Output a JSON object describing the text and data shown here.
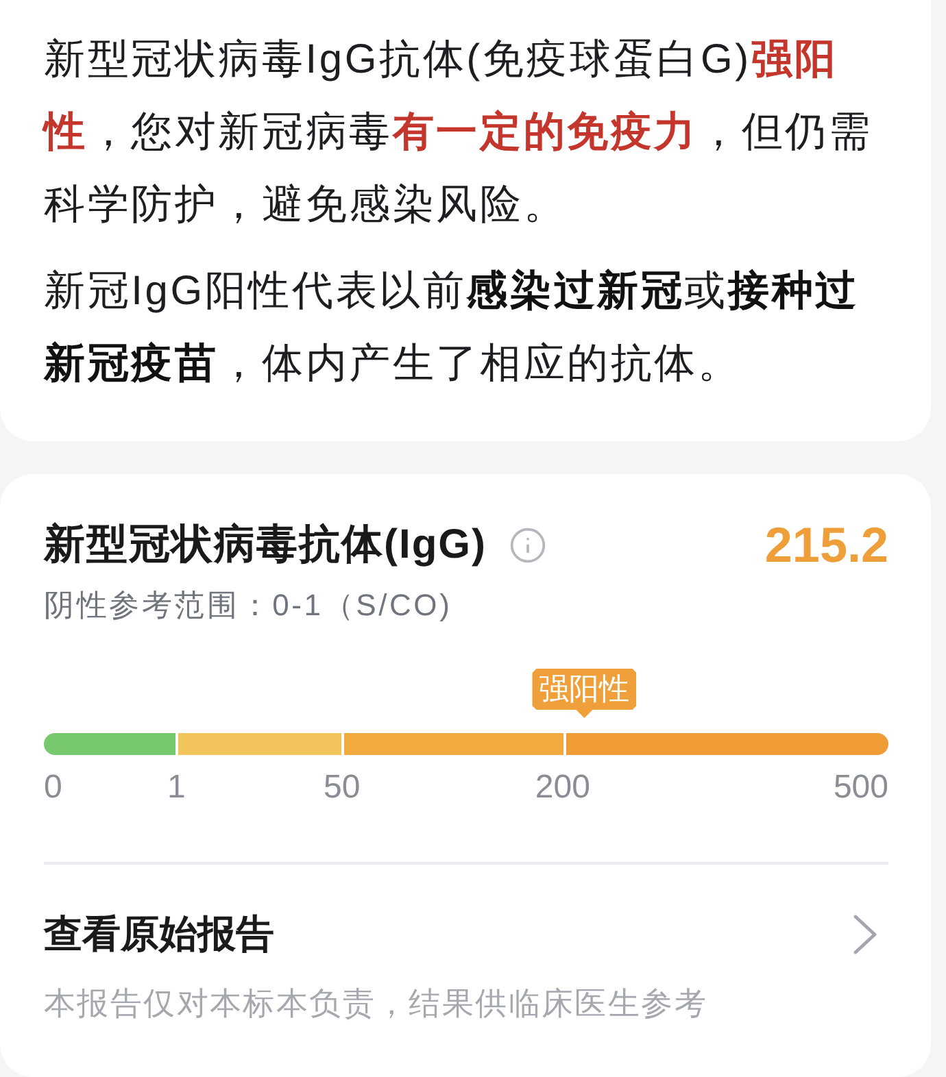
{
  "summary": {
    "paragraphs": [
      {
        "runs": [
          {
            "kind": "plain",
            "text": "新型冠状病毒IgG抗体(免疫球蛋白G)"
          },
          {
            "kind": "highlight",
            "text": "强阳性"
          },
          {
            "kind": "plain",
            "text": "，您对新冠病毒"
          },
          {
            "kind": "highlight",
            "text": "有一定的免疫力"
          },
          {
            "kind": "plain",
            "text": "，但仍需科学防护，避免感染风险。"
          }
        ]
      },
      {
        "runs": [
          {
            "kind": "plain",
            "text": "新冠IgG阳性代表以前"
          },
          {
            "kind": "strong",
            "text": "感染过新冠"
          },
          {
            "kind": "plain",
            "text": "或"
          },
          {
            "kind": "strong",
            "text": "接种过新冠疫苗"
          },
          {
            "kind": "plain",
            "text": "，体内产生了相应的抗体。"
          }
        ]
      }
    ]
  },
  "result": {
    "title": "新型冠状病毒抗体(IgG)",
    "value": "215.2",
    "reference": "阴性参考范围：0-1（S/CO)",
    "scale": {
      "segments": [
        {
          "color": "#78c86e"
        },
        {
          "color": "#f2c45c"
        },
        {
          "color": "#f0aa3e"
        },
        {
          "color": "#ef9c37"
        }
      ],
      "ticks": [
        "0",
        "1",
        "50",
        "200",
        "500"
      ],
      "marker": {
        "label": "强阳性",
        "level": 0.64
      }
    }
  },
  "report_link": {
    "label": "查看原始报告"
  },
  "disclaimer": "本报告仅对本标本负责，结果供临床医生参考"
}
